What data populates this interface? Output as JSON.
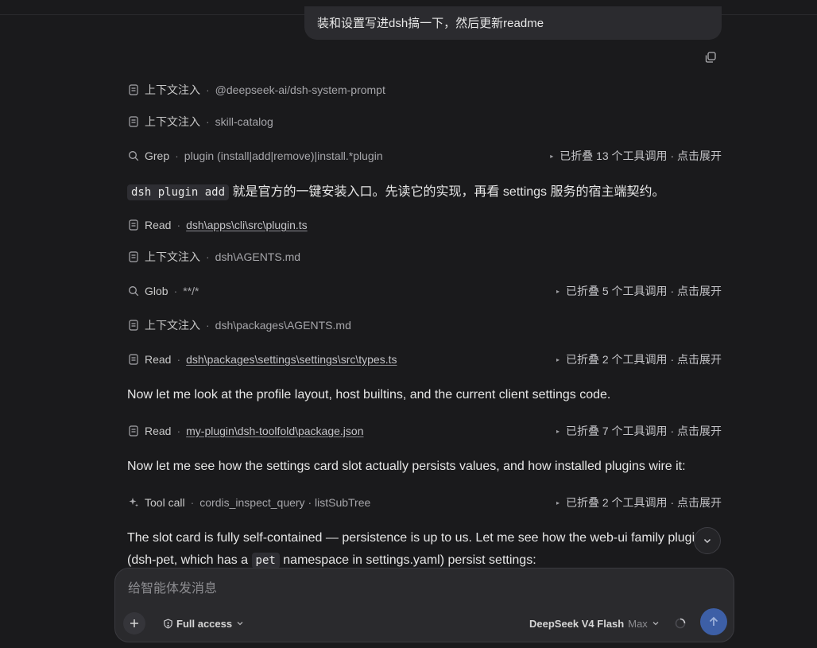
{
  "user_message": "装和设置写进dsh搞一下，然后更新readme",
  "transcript": {
    "r1": {
      "kind": "上下文注入",
      "arg": "@deepseek-ai/dsh-system-prompt"
    },
    "r2": {
      "kind": "上下文注入",
      "arg": "skill-catalog"
    },
    "r3": {
      "kind": "Grep",
      "arg": "plugin (install|add|remove)|install.*plugin",
      "fold": "已折叠 13 个工具调用 · 点击展开"
    },
    "p1": {
      "code": "dsh plugin add",
      "text": "就是官方的一键安装入口。先读它的实现，再看 settings 服务的宿主端契约。"
    },
    "r4": {
      "kind": "Read",
      "arg": "dsh\\apps\\cli\\src\\plugin.ts"
    },
    "r5": {
      "kind": "上下文注入",
      "arg": "dsh\\AGENTS.md"
    },
    "r6": {
      "kind": "Glob",
      "arg": "**/*",
      "fold": "已折叠 5 个工具调用 · 点击展开"
    },
    "r7": {
      "kind": "上下文注入",
      "arg": "dsh\\packages\\AGENTS.md"
    },
    "r8": {
      "kind": "Read",
      "arg": "dsh\\packages\\settings\\settings\\src\\types.ts",
      "fold": "已折叠 2 个工具调用 · 点击展开"
    },
    "p2": {
      "text": "Now let me look at the profile layout, host builtins, and the current client settings code."
    },
    "r9": {
      "kind": "Read",
      "arg": "my-plugin\\dsh-toolfold\\package.json",
      "fold": "已折叠 7 个工具调用 · 点击展开"
    },
    "p3": {
      "text": "Now let me see how the settings card slot actually persists values, and how installed plugins wire it:"
    },
    "r10": {
      "kind": "Tool call",
      "arg": "cordis_inspect_query · listSubTree",
      "fold": "已折叠 2 个工具调用 · 点击展开"
    },
    "p4": {
      "line1": "The slot card is fully self-contained — persistence is up to us. Let me see how the web-ui family plugin",
      "line2a": "(dsh-pet, which has a",
      "code": "pet",
      "line2b": "namespace in settings.yaml) persist settings:"
    }
  },
  "separator": "·",
  "composer": {
    "placeholder": "给智能体发消息",
    "access_label": "Full access",
    "model_name": "DeepSeek V4 Flash",
    "model_mode": "Max"
  },
  "colors": {
    "accent": "#3d5fa6",
    "background": "#1a1a1c"
  }
}
